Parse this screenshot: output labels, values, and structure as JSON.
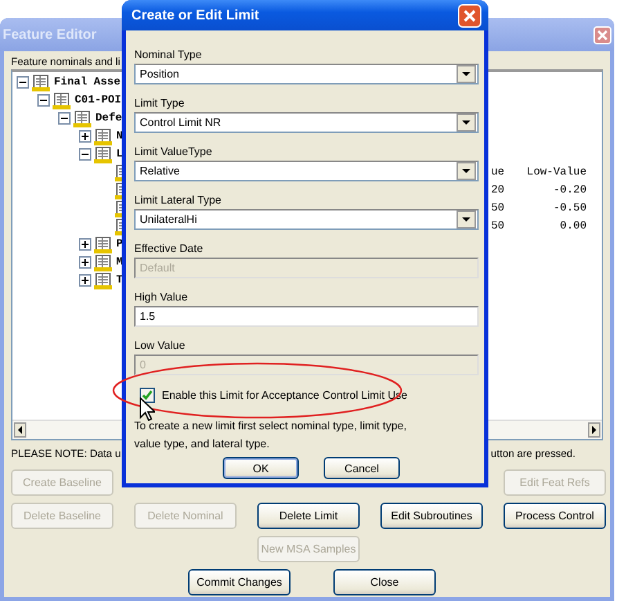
{
  "window": {
    "title": "Feature Editor",
    "tree_label": "Feature nominals and li",
    "tree": [
      {
        "kind": "node",
        "label": "Final Asse",
        "expanded": true,
        "children": [
          {
            "kind": "node",
            "label": "C01-POI",
            "expanded": true,
            "children": [
              {
                "kind": "node",
                "label": "Defe",
                "expanded": true,
                "children": [
                  {
                    "kind": "node",
                    "label": "N",
                    "expanded": false
                  },
                  {
                    "kind": "node",
                    "label": "L",
                    "expanded": true,
                    "children": [
                      {
                        "kind": "leaf"
                      },
                      {
                        "kind": "leaf"
                      },
                      {
                        "kind": "leaf"
                      },
                      {
                        "kind": "leaf"
                      }
                    ]
                  },
                  {
                    "kind": "node",
                    "label": "P",
                    "expanded": false
                  },
                  {
                    "kind": "node",
                    "label": "M",
                    "expanded": false
                  },
                  {
                    "kind": "node",
                    "label": "T",
                    "expanded": false
                  }
                ]
              }
            ]
          }
        ]
      }
    ],
    "grid": {
      "columns": [
        "ue",
        "Low-Value"
      ],
      "rows": [
        [
          "20",
          "-0.20"
        ],
        [
          "50",
          "-0.50"
        ],
        [
          "50",
          "0.00"
        ]
      ]
    },
    "note_left": "PLEASE NOTE: Data u",
    "note_right": "utton are pressed.",
    "button_rows": [
      [
        {
          "label": "Create Baseline",
          "disabled": true
        },
        null,
        null,
        null,
        {
          "label": "Edit Feat Refs",
          "disabled": true
        }
      ],
      [
        {
          "label": "Delete Baseline",
          "disabled": true
        },
        {
          "label": "Delete Nominal",
          "disabled": true
        },
        {
          "label": "Delete Limit",
          "disabled": false
        },
        {
          "label": "Edit Subroutines",
          "disabled": false
        },
        {
          "label": "Process Control",
          "disabled": false
        }
      ],
      [
        null,
        null,
        {
          "label": "New MSA Samples",
          "disabled": true
        },
        null,
        null
      ]
    ],
    "actions": [
      {
        "label": "Commit Changes",
        "disabled": false
      },
      {
        "label": "Close",
        "disabled": false
      }
    ]
  },
  "dialog": {
    "title": "Create or Edit Limit",
    "fields": [
      {
        "kind": "combo",
        "label": "Nominal Type",
        "value": "Position",
        "disabled": false
      },
      {
        "kind": "combo",
        "label": "Limit Type",
        "value": "Control Limit NR",
        "disabled": false
      },
      {
        "kind": "combo",
        "label": "Limit ValueType",
        "value": "Relative",
        "disabled": false
      },
      {
        "kind": "combo",
        "label": "Limit Lateral Type",
        "value": "UnilateralHi",
        "disabled": false
      },
      {
        "kind": "text",
        "label": "Effective Date",
        "value": "Default",
        "disabled": true
      },
      {
        "kind": "text",
        "label": "High Value",
        "value": "1.5",
        "disabled": false
      },
      {
        "kind": "text",
        "label": "Low Value",
        "value": "0",
        "disabled": true
      }
    ],
    "checkbox": {
      "label": "Enable this Limit for Acceptance Control Limit Use",
      "checked": true
    },
    "hint": "To create a new limit first select nominal type, limit type, value type, and lateral type.",
    "buttons": [
      {
        "label": "OK",
        "default": true
      },
      {
        "label": "Cancel",
        "default": false
      }
    ]
  }
}
